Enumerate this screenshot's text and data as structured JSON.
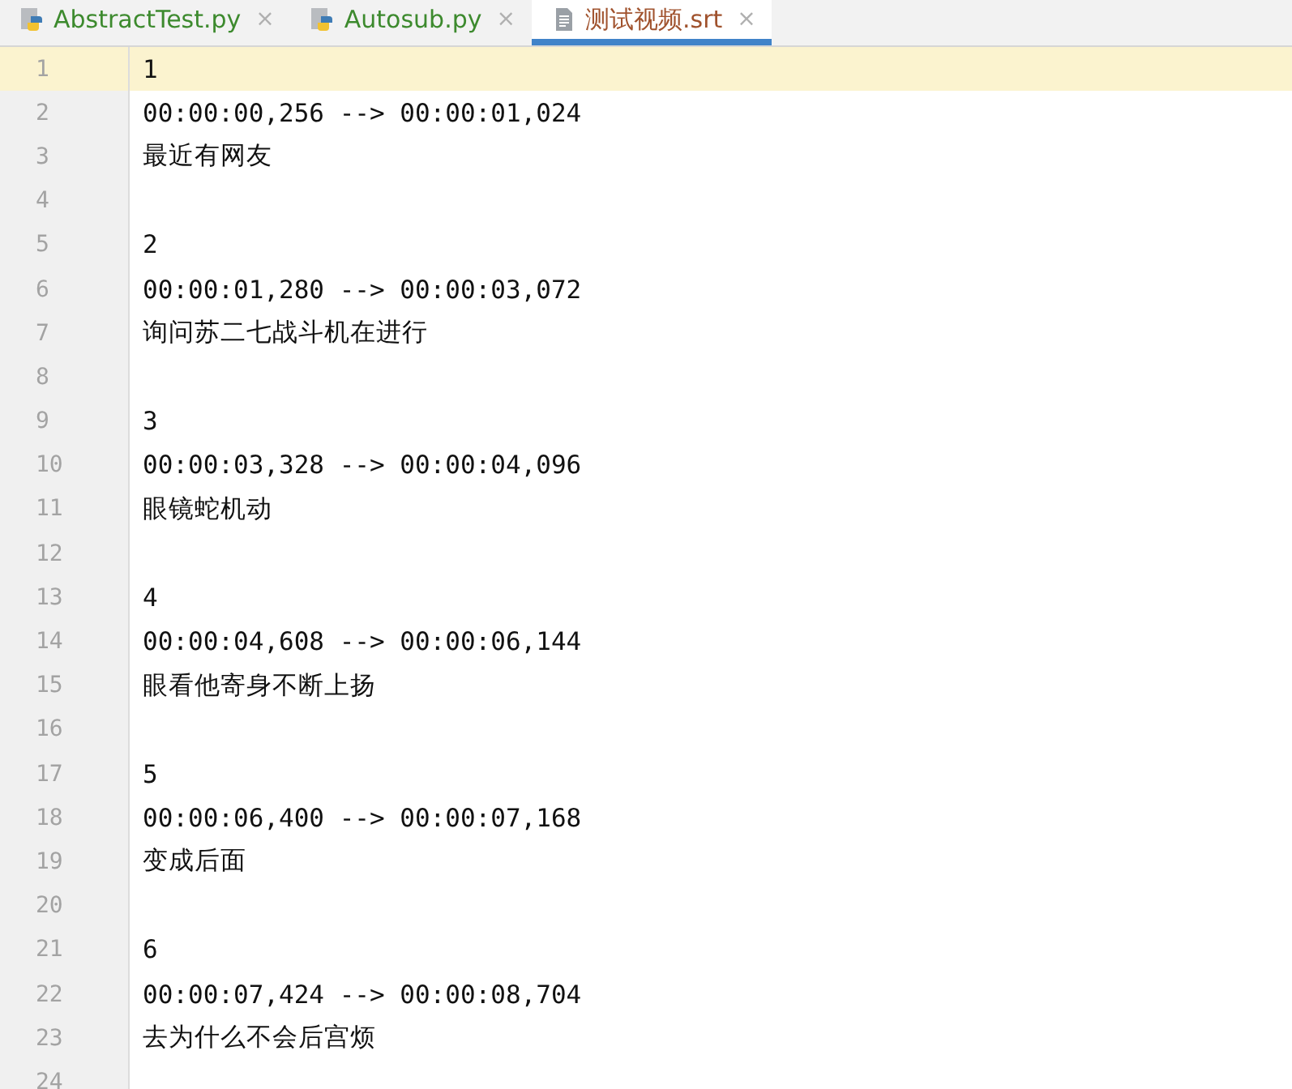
{
  "tabs": [
    {
      "label": "AbstractTest.py",
      "kind": "python",
      "color": "#3d8a2e",
      "selected": false,
      "close": "×"
    },
    {
      "label": "Autosub.py",
      "kind": "python",
      "color": "#3d8a2e",
      "selected": false,
      "close": "×"
    },
    {
      "label": "测试视频.srt",
      "kind": "text",
      "color": "#a0522d",
      "selected": true,
      "close": "×"
    }
  ],
  "lines": [
    {
      "number": "1",
      "text": "1",
      "current": true
    },
    {
      "number": "2",
      "text": "00:00:00,256 --> 00:00:01,024",
      "current": false
    },
    {
      "number": "3",
      "text": "最近有网友",
      "current": false
    },
    {
      "number": "4",
      "current": false
    },
    {
      "number": "5",
      "text": "2",
      "current": false
    },
    {
      "number": "6",
      "text": "00:00:01,280 --> 00:00:03,072",
      "current": false
    },
    {
      "number": "7",
      "text": "询问苏二七战斗机在进行",
      "current": false
    },
    {
      "number": "8",
      "current": false
    },
    {
      "number": "9",
      "text": "3",
      "current": false
    },
    {
      "number": "10",
      "text": "00:00:03,328 --> 00:00:04,096",
      "current": false
    },
    {
      "number": "11",
      "text": "眼镜蛇机动",
      "current": false
    },
    {
      "number": "12",
      "current": false
    },
    {
      "number": "13",
      "text": "4",
      "current": false
    },
    {
      "number": "14",
      "text": "00:00:04,608 --> 00:00:06,144",
      "current": false
    },
    {
      "number": "15",
      "text": "眼看他寄身不断上扬",
      "current": false
    },
    {
      "number": "16",
      "current": false
    },
    {
      "number": "17",
      "text": "5",
      "current": false
    },
    {
      "number": "18",
      "text": "00:00:06,400 --> 00:00:07,168",
      "current": false
    },
    {
      "number": "19",
      "text": "变成后面",
      "current": false
    },
    {
      "number": "20",
      "current": false
    },
    {
      "number": "21",
      "text": "6",
      "current": false
    },
    {
      "number": "22",
      "text": "00:00:07,424 --> 00:00:08,704",
      "current": false
    },
    {
      "number": "23",
      "text": "去为什么不会后宫烦",
      "current": false
    },
    {
      "number": "24",
      "current": false
    }
  ]
}
